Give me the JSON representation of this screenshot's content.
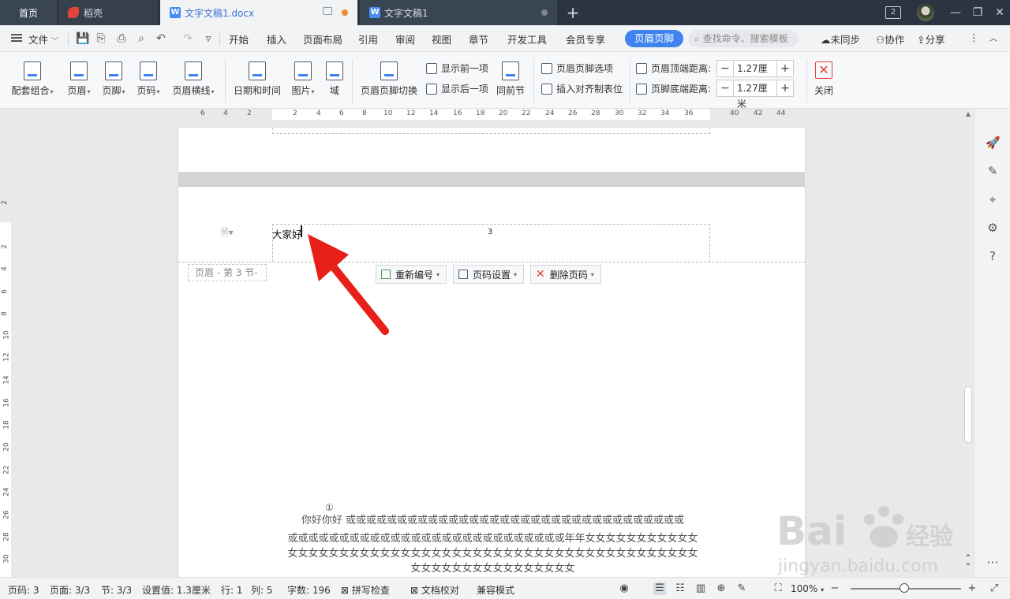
{
  "tabs": {
    "home": "首页",
    "daoke": "稻壳",
    "doc1": "文字文稿1.docx",
    "doc2": "文字文稿1",
    "badge": "2"
  },
  "menu": {
    "file": "文件",
    "items": [
      "开始",
      "插入",
      "页面布局",
      "引用",
      "审阅",
      "视图",
      "章节",
      "开发工具",
      "会员专享"
    ],
    "active": "页眉页脚",
    "search": "查找命令、搜索模板",
    "sync": "未同步",
    "collab": "协作",
    "share": "分享"
  },
  "ribbon": {
    "combo": "配套组合",
    "header": "页眉",
    "footer": "页脚",
    "pagenum": "页码",
    "header_line": "页眉横线",
    "datetime": "日期和时间",
    "picture": "图片",
    "field": "域",
    "switch": "页眉页脚切换",
    "show_prev": "显示前一项",
    "show_next": "显示后一项",
    "same_prev": "同前节",
    "hf_options": "页眉页脚选项",
    "align_tab": "插入对齐制表位",
    "header_top_label": "页眉顶端距离:",
    "header_top_value": "1.27厘米",
    "footer_bottom_label": "页脚底端距离:",
    "footer_bottom_value": "1.27厘米",
    "close": "关闭"
  },
  "ruler": {
    "h_labels": [
      "6",
      "4",
      "2",
      "2",
      "4",
      "6",
      "8",
      "10",
      "12",
      "14",
      "16",
      "18",
      "20",
      "22",
      "24",
      "26",
      "28",
      "30",
      "32",
      "34",
      "36",
      "40",
      "42",
      "44"
    ],
    "v_labels": [
      "2",
      "2",
      "4",
      "6",
      "8",
      "10",
      "12",
      "14",
      "16",
      "18",
      "20",
      "22",
      "24",
      "26",
      "28",
      "30"
    ]
  },
  "document": {
    "header_text": "大家好",
    "page_number": "3",
    "header_label": "页眉 - 第 3 节-",
    "btn_renumber": "重新编号",
    "btn_pagenum_settings": "页码设置",
    "btn_delete_pagenum": "删除页码",
    "footnote_mark": "①",
    "body_lines": [
      "你好你好     或或或或或或或或或或或或或或或或或或或或或或或或或或或或或或或或或",
      "或或或或或或或或或或或或或或或或或或或或或或或或或或或年年女女女女女女女女女女女",
      "女女女女女女女女女女女女女女女女女女女女女女女女女女女女女女女女女女女女女女女女",
      "女女女女女女女女女女女女女女女女"
    ]
  },
  "status": {
    "page": "页码: 3",
    "pages": "页面: 3/3",
    "section": "节: 3/3",
    "setting": "设置值: 1.3厘米",
    "row": "行: 1",
    "col": "列: 5",
    "words": "字数: 196",
    "spell": "拼写检查",
    "proof": "文档校对",
    "compat": "兼容模式",
    "zoom": "100%"
  },
  "watermark": {
    "brand": "Bai",
    "brand_cn": "经验",
    "url": "jingyan.baidu.com"
  },
  "colors": {
    "accent": "#3f83ef",
    "arrow": "#e8201a",
    "tab_bar": "#2b3440"
  }
}
